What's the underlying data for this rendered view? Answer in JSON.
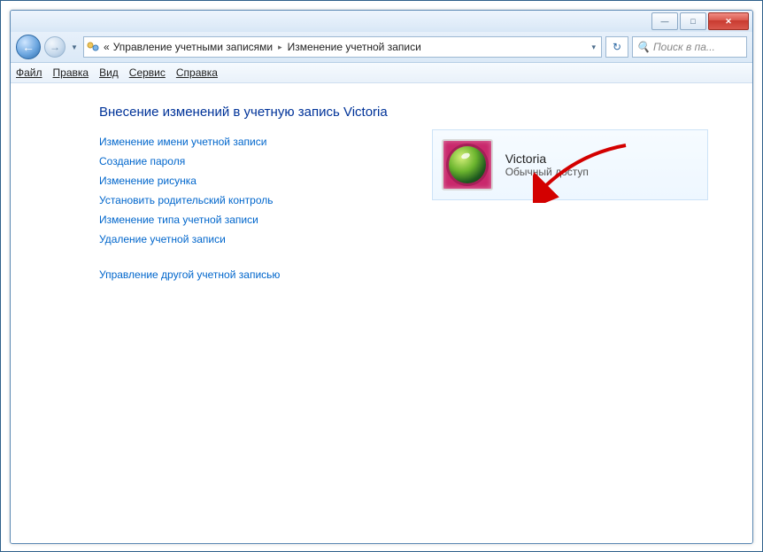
{
  "titlebar": {
    "minimize_glyph": "—",
    "maximize_glyph": "□",
    "close_glyph": "✕"
  },
  "nav": {
    "back_glyph": "←",
    "forward_glyph": "→",
    "dropdown_glyph": "▼",
    "refresh_glyph": "↻"
  },
  "address": {
    "prefix": "«",
    "crumb1": "Управление учетными записями",
    "sep": "▸",
    "crumb2": "Изменение учетной записи",
    "dropdown_glyph": "▾"
  },
  "search": {
    "placeholder": "Поиск в па...",
    "icon": "🔍"
  },
  "menu": {
    "file": "Файл",
    "edit": "Правка",
    "view": "Вид",
    "tools": "Сервис",
    "help": "Справка"
  },
  "heading": "Внесение изменений в учетную запись Victoria",
  "links": {
    "rename": "Изменение имени учетной записи",
    "create_password": "Создание пароля",
    "change_picture": "Изменение рисунка",
    "parental": "Установить родительский контроль",
    "change_type": "Изменение типа учетной записи",
    "delete": "Удаление учетной записи",
    "manage_other": "Управление другой учетной записью"
  },
  "user": {
    "name": "Victoria",
    "type": "Обычный доступ"
  }
}
